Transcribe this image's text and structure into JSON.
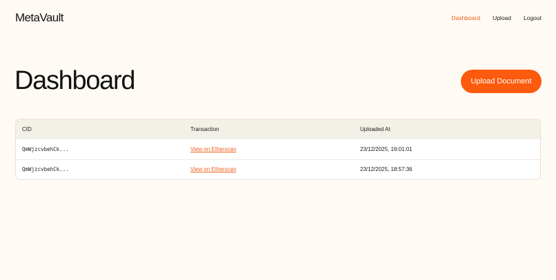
{
  "app": {
    "logo": "MetaVault"
  },
  "nav": {
    "items": [
      {
        "label": "Dashboard",
        "active": true
      },
      {
        "label": "Upload",
        "active": false
      },
      {
        "label": "Logout",
        "active": false
      }
    ]
  },
  "page": {
    "title": "Dashboard",
    "upload_button": "Upload Document"
  },
  "table": {
    "columns": [
      "CID",
      "Transaction",
      "Uploaded At"
    ],
    "rows": [
      {
        "cid": "QmWjzcvbehCk...",
        "transaction": "View on Etherscan",
        "uploaded_at": "23/12/2025, 19:01:01"
      },
      {
        "cid": "QmWjzcvbehCk...",
        "transaction": "View on Etherscan",
        "uploaded_at": "23/12/2025, 18:57:36"
      }
    ]
  },
  "colors": {
    "background": "#fffbf4",
    "accent": "#fc5a0c",
    "active_nav": "#f25c1b",
    "table_header": "#f3f0e8"
  }
}
